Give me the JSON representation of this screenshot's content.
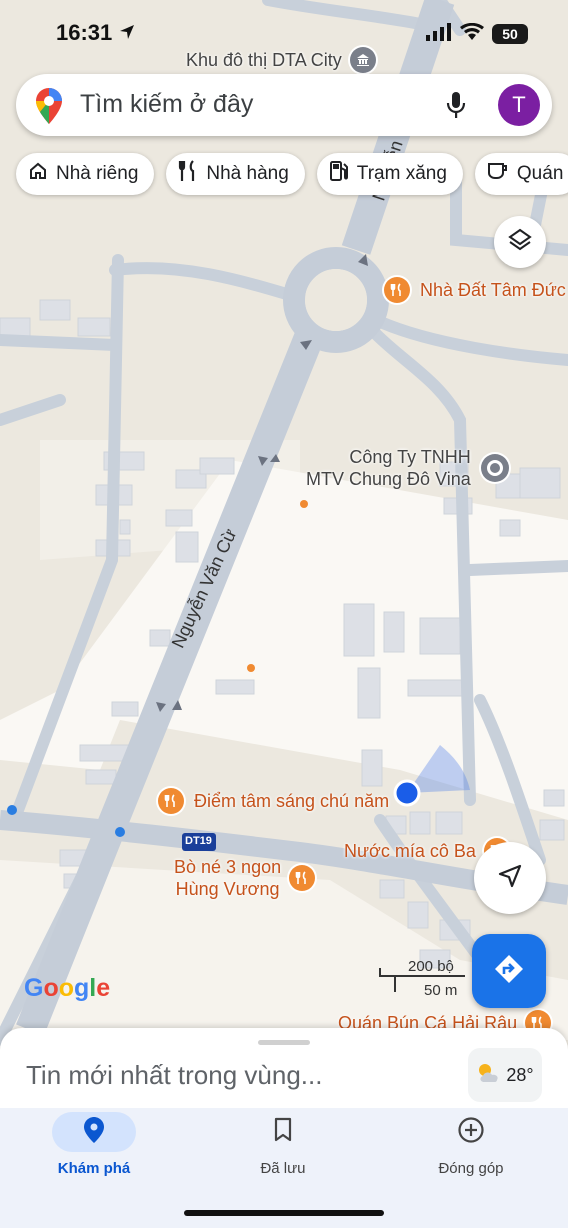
{
  "status": {
    "time": "16:31",
    "battery": "50"
  },
  "search": {
    "placeholder": "Tìm kiếm ở đây",
    "avatar_letter": "T"
  },
  "chips": [
    {
      "label": "Nhà riêng",
      "icon": "home-icon"
    },
    {
      "label": "Nhà hàng",
      "icon": "restaurant-icon"
    },
    {
      "label": "Trạm xăng",
      "icon": "gas-station-icon"
    },
    {
      "label": "Quán",
      "icon": "cafe-icon"
    }
  ],
  "map": {
    "places": {
      "dta_city": "Khu đô thị DTA City",
      "nha_dat": "Nhà Đất Tâm Đức",
      "cong_ty_line1": "Công Ty TNHH",
      "cong_ty_line2": "MTV Chung Đô Vina",
      "diem_tam": "Điểm tâm sáng chú năm",
      "nuoc_mia": "Nước mía cô Ba",
      "bo_ne_line1": "Bò né 3 ngon",
      "bo_ne_line2": "Hùng Vương",
      "quan_bun": "Quán Bún Cá Hải Râu"
    },
    "roads": {
      "nguyen_van_cu": "Nguyễn Văn Cừ",
      "nguyen_van_cu_top": "Nguyễn Văn C",
      "route_badge": "DT19"
    },
    "scale": {
      "top": "200 bộ",
      "bottom": "50 m"
    },
    "logo": "Google"
  },
  "sheet": {
    "news": "Tin mới nhất trong vùng...",
    "temperature": "28°"
  },
  "nav": [
    {
      "label": "Khám phá",
      "icon": "explore-pin-icon",
      "active": true
    },
    {
      "label": "Đã lưu",
      "icon": "bookmark-icon",
      "active": false
    },
    {
      "label": "Đóng góp",
      "icon": "add-circle-icon",
      "active": false
    }
  ],
  "colors": {
    "accent": "#1a73e8",
    "poi_orange": "#f08a31",
    "avatar": "#7b1fa2"
  }
}
